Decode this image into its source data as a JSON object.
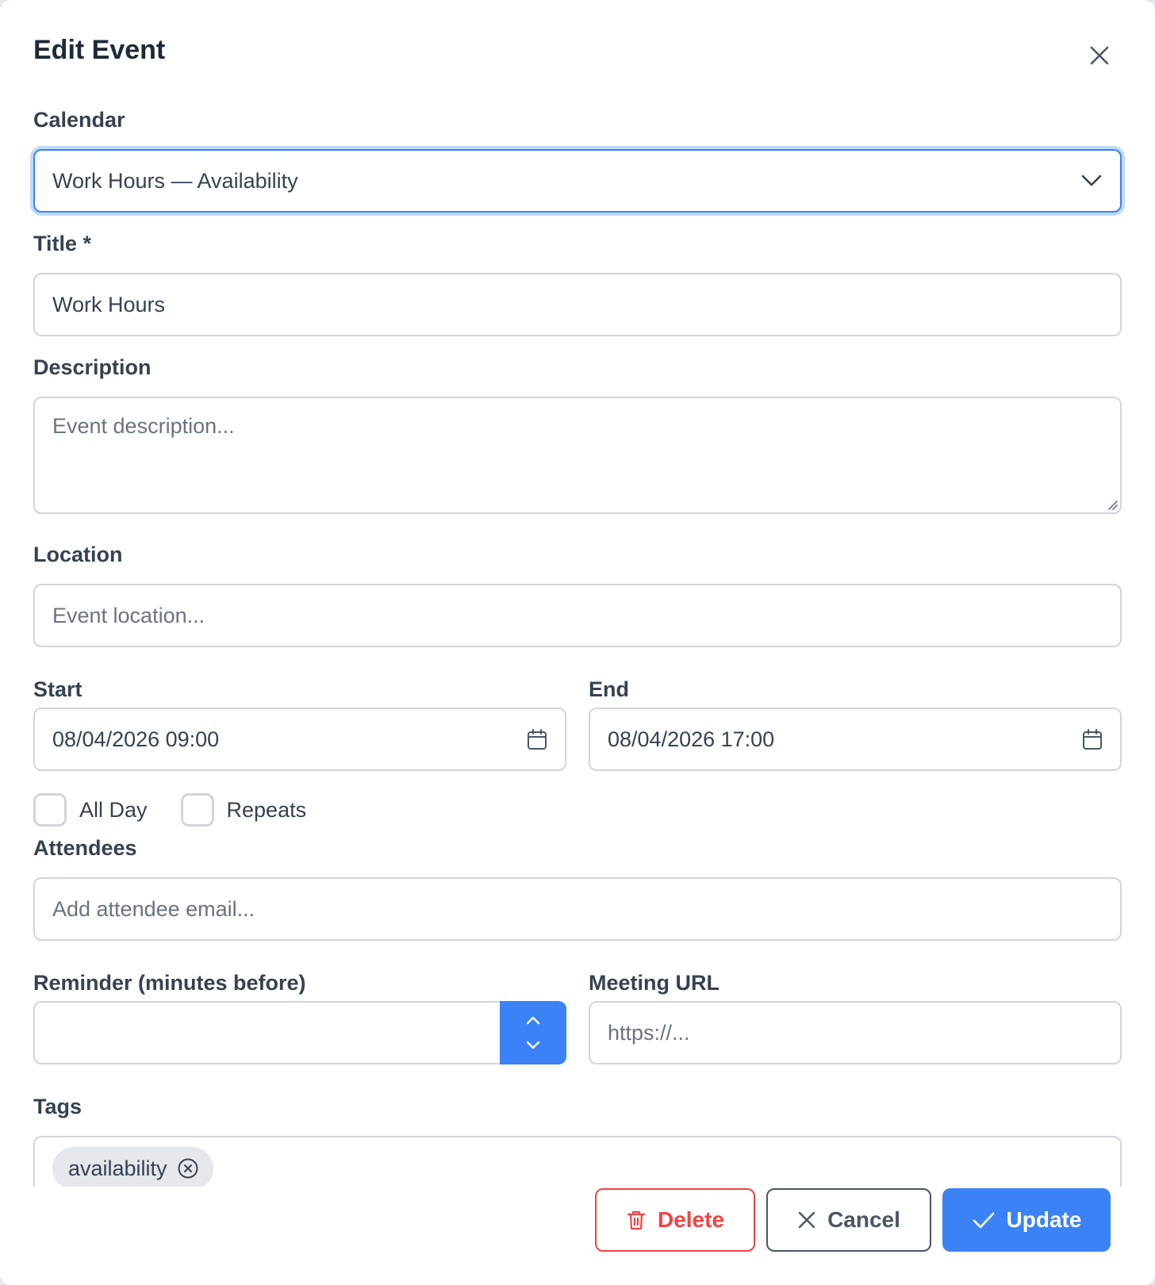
{
  "modal": {
    "title": "Edit Event",
    "close_icon": "close-icon"
  },
  "calendar": {
    "label": "Calendar",
    "value": "Work Hours — Availability",
    "icon": "chevron-down-icon"
  },
  "title_field": {
    "label": "Title *",
    "value": "Work Hours"
  },
  "description": {
    "label": "Description",
    "placeholder": "Event description..."
  },
  "location": {
    "label": "Location",
    "placeholder": "Event location..."
  },
  "start": {
    "label": "Start",
    "value": "08/04/2026 09:00",
    "icon": "calendar-icon"
  },
  "end": {
    "label": "End",
    "value": "08/04/2026 17:00",
    "icon": "calendar-icon"
  },
  "options": {
    "all_day": {
      "label": "All Day",
      "checked": false
    },
    "repeats": {
      "label": "Repeats",
      "checked": false
    }
  },
  "attendees": {
    "label": "Attendees",
    "placeholder": "Add attendee email..."
  },
  "reminder": {
    "label": "Reminder (minutes before)",
    "value": ""
  },
  "meeting_url": {
    "label": "Meeting URL",
    "placeholder": "https://..."
  },
  "tags": {
    "label": "Tags",
    "items": [
      "availability"
    ]
  },
  "footer": {
    "delete_label": "Delete",
    "cancel_label": "Cancel",
    "update_label": "Update"
  },
  "colors": {
    "primary": "#3b82f6",
    "danger": "#ef4444",
    "border": "#d1d5db",
    "text": "#374151"
  }
}
